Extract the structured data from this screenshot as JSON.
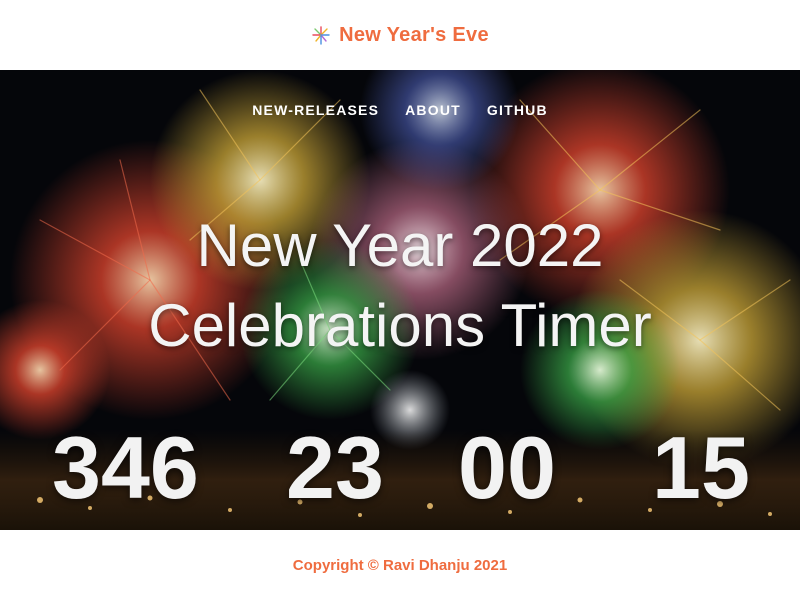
{
  "header": {
    "icon": "fireworks-icon",
    "title": "New Year's Eve"
  },
  "nav": {
    "items": [
      {
        "label": "NEW-RELEASES"
      },
      {
        "label": "ABOUT"
      },
      {
        "label": "GITHUB"
      }
    ]
  },
  "hero": {
    "title_line1": "New Year 2022",
    "title_line2": "Celebrations Timer",
    "background": "fireworks night sky over city"
  },
  "timer": {
    "days": "346",
    "hours": "23",
    "minutes": "00",
    "seconds": "15"
  },
  "footer": {
    "copyright": "Copyright © Ravi Dhanju 2021"
  },
  "colors": {
    "accent": "#ef6c3f",
    "hero_text": "#f4f4f4",
    "hero_bg": "#05060a"
  }
}
